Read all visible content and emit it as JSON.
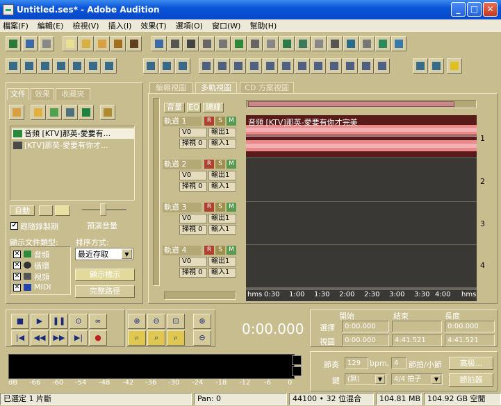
{
  "window": {
    "title": "Untitled.ses* - Adobe Audition"
  },
  "menu": [
    "檔案(F)",
    "編輯(E)",
    "檢視(V)",
    "插入(I)",
    "效果(T)",
    "選項(O)",
    "窗口(W)",
    "幫助(H)"
  ],
  "left_panel": {
    "tabs": [
      "文件",
      "效果",
      "收藏夾"
    ],
    "files": [
      "音頻 [KTV]那英-愛要有...",
      "[KTV]那英-愛要有你才..."
    ],
    "auto_label": "自動",
    "follow_label": "跟隨錄製期",
    "preview_volume_label": "預演音量",
    "show_types_label": "顯示文件類型:",
    "types": [
      "音頻",
      "循環",
      "視頻",
      "MIDI"
    ],
    "sort_label": "排序方式:",
    "sort_value": "最近存取",
    "show_hints_button": "顯示標示",
    "full_path_button": "完整路徑"
  },
  "view_tabs": [
    "編輯視圖",
    "多軌視圖",
    "CD 方案視圖"
  ],
  "track_header_tabs": [
    "音量",
    "EQ",
    "總線"
  ],
  "tracks": [
    {
      "name": "軌道 1",
      "volume": "V0",
      "pan": "掃視 0",
      "out": "輸出1",
      "in": "輸入1",
      "number": "1"
    },
    {
      "name": "軌道 2",
      "volume": "V0",
      "pan": "掃視 0",
      "out": "輸出1",
      "in": "輸入1",
      "number": "2"
    },
    {
      "name": "軌道 3",
      "volume": "V0",
      "pan": "掃視 0",
      "out": "輸出1",
      "in": "輸入1",
      "number": "3"
    },
    {
      "name": "軌道 4",
      "volume": "V0",
      "pan": "掃視 0",
      "out": "輸出1",
      "in": "輸入1",
      "number": "4"
    }
  ],
  "rsm": [
    "R",
    "S",
    "M"
  ],
  "clip_label": "音頻 [KTV]那英-愛要有你才完美",
  "timeline": [
    "hms",
    "0:30",
    "1:00",
    "1:30",
    "2:00",
    "2:30",
    "3:00",
    "3:30",
    "4:00",
    "hms"
  ],
  "time_display": "0:00.000",
  "selection": {
    "headers": [
      "開始",
      "結束",
      "長度"
    ],
    "select_label": "選擇",
    "view_label": "視圖",
    "select": [
      "0:00.000",
      "",
      "0:00.000"
    ],
    "view": [
      "0:00.000",
      "4:41.521",
      "4:41.521"
    ]
  },
  "tempo": {
    "label": "節奏",
    "bpm": "129",
    "bpm_unit": "bpm,",
    "beats": "4",
    "beats_unit": "節拍/小節",
    "advanced_button": "高級...",
    "key_label": "鍵",
    "key_value": "(無)",
    "time_sig": "4/4 拍子",
    "metronome_button": "節拍器"
  },
  "meter_scale": [
    "dB",
    "-66",
    "-60",
    "-54",
    "-48",
    "-42",
    "-36",
    "-30",
    "-24",
    "-18",
    "-12",
    "-6",
    "0"
  ],
  "status": {
    "selected": "已選定 1 片斷",
    "pan": "Pan: 0",
    "format": "44100 • 32 位混合",
    "size": "104.81 MB",
    "disk": "104.92 GB 空閒"
  }
}
